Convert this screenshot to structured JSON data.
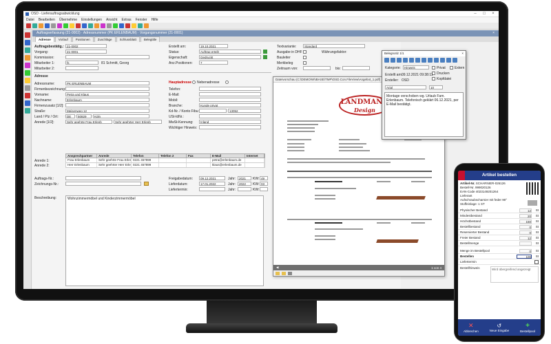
{
  "app": {
    "title": "OSD - Lieferauftragsabwicklung",
    "menu": [
      "Datei",
      "Bearbeiten",
      "Übernehme",
      "Einstellungen",
      "Ansicht",
      "Extras",
      "Fenster",
      "Hilfe"
    ],
    "subtitle": "Auftragserfassung (21-0002) · Adressnummer (PK ERLENBAUM) · Vorgangsnummer (21-0001)",
    "tabs": [
      "Adresse",
      "Vorlauf",
      "Positionen",
      "Zuschläge",
      "Schlussblatt",
      "Belegtitle"
    ]
  },
  "form": {
    "auftragsbestaetigung_label": "Auftragsbestätig.:",
    "auftragsbestaetigung": "21-0002",
    "vorgang_label": "Vorgang:",
    "vorgang": "21-0001",
    "kommission_label": "Kommission:",
    "mitarbeiter1_label": "Mitarbeiter 1:",
    "mitarbeiter1_code": "fs",
    "mitarbeiter1": "81 Schmitt, Georg",
    "mitarbeiter2_label": "Mitarbeiter 2:",
    "erstellt_label": "Erstellt am:",
    "erstellt": "19.10.2021",
    "status_label": "Status:",
    "status": "Auftrag erteilt",
    "eigenschaft_label": "Eigenschaft:",
    "eigenschaft": "Gedruckt",
    "anzpos_label": "Anz.Positionen:",
    "anzpos": "7",
    "textvariante_label": "Textvariante:",
    "textvariante": "Standard",
    "ausgabe_label": "Ausgabe in DHF",
    "waehrung_label": "Währungsfaktor:",
    "bauleiter_label": "Bauleiter",
    "merkbeleg_label": "Merkbeleg",
    "zeitraum_label": "Zeitraum von:",
    "bis_label": "bis:",
    "adresse_section": "Adresse",
    "hauptadresse_label": "Hauptadresse",
    "nebenadresse_label": "Nebenadresse",
    "adressname_label": "Adressname:",
    "adressname": "PK ERLENBAUM",
    "firmen_label": "Firmenbezeichnung:",
    "vorname_label": "Vorname:",
    "vorname": "Petra und Klaus",
    "nachname_label": "Nachname:",
    "nachname": "Erlenbaum",
    "firmenzusatz_label": "Firmenzusatz [1/2]:",
    "strasse_label": "Straße:",
    "strasse": "Meisenweg 12",
    "lpo_label": "Land / Plz / Ort:",
    "land": "DE",
    "plz": "50829",
    "ort": "Köln",
    "anrede_label": "Anrede [1/2]:",
    "anrede": "Sehr geehrte Frau Erlenb",
    "anrede2": "Sehr geehrter Herr Erlenb",
    "telefon_label": "Telefon:",
    "email_label": "E-Mail:",
    "mobil_label": "Mobil:",
    "branche_label": "Branche:",
    "branche": "Kunde privat",
    "kdnr_label": "Kd-Nr. / Konto Fibu:",
    "kdnr": "13052",
    "ustid_label": "USt-IdNr.:",
    "mwst_label": "MwSt-Kennung:",
    "mwst": "Inland",
    "hinweis_label": "Wichtiger Hinweis:",
    "auftragsnr_label": "Auftrags-Nr.:",
    "zeichnung_label": "Zeichnungs-Nr.:",
    "freigabe_label": "Freigabedatum:",
    "freigabe": "09.12.2021",
    "jahr_label": "Jahr:",
    "freigabe_jahr": "2021",
    "kw_label": "KW:",
    "freigabe_kw": "49",
    "liefer_label": "Lieferdatum:",
    "liefer": "17.01.2022",
    "liefer_jahr": "2022",
    "liefer_kw": "03",
    "liefertermin_label": "Liefertermin:",
    "liefertermin_jahr": "",
    "liefertermin_kw": "",
    "beschreibung_label": "Beschreibung:",
    "beschreibung": "Wohnzimmermöbel und Kinderzimmermöbel"
  },
  "contacts": {
    "headers": [
      "",
      "Ansprechpartner",
      "Anrede",
      "Telefon",
      "Telefon 2",
      "Fax",
      "E-Mail",
      "Internet"
    ],
    "rows": [
      [
        "Anrede 1:",
        "Frau Erlenbaum",
        "Sehr geehrte Frau Erlen",
        "0221 457899",
        "",
        "",
        "petra@erlenbaum.de",
        ""
      ],
      [
        "Anrede 2:",
        "Herr Erlenbaum",
        "Sehr geehrter Herr Erlen",
        "0221 457899",
        "",
        "",
        "klaus@erlenbaum.de",
        ""
      ]
    ]
  },
  "document": {
    "title": "Dateivorschau (C:\\DEMO\\W\\IBASE\\TMP\\OSD.Con.FileView\\Angebot_1.pdf)",
    "logo1": "LANDMANN",
    "logo2": "Design",
    "page": "1 von 4"
  },
  "note": {
    "title": "Belegnotiz 1/1",
    "kategorie_label": "Kategorie:",
    "kategorie": "Hinweis",
    "privat_label": "Privat",
    "extern_label": "Extern",
    "drucken_label": "Drucken",
    "kopf_label": "Kopfdatei",
    "erstellt_label": "Erstellt am:",
    "erstellt": "09.12.2021 09:38:11",
    "ersteller_label": "Ersteller:",
    "ersteller": "OSD",
    "font": "Arial",
    "size": "10",
    "text": "Montage verschoben wg. Urlaub Fam. Erlenbaum. Telefonisch geklärt 06.12.2021, per E-Mail bestätigt."
  },
  "phone": {
    "title": "Artikel bestellen",
    "artikel_label": "Artikel-Nr.",
    "artikel": "SCHARNIER-026126",
    "bestell_label": "Bestell-Nr.",
    "bestell": "999020126",
    "ean_label": "EAN-Code",
    "ean": "4023149201264",
    "lieferant_label": "Lieferant",
    "desc1": "Aufschraubscharnier mit feder 90°",
    "desc2": "Stoffeinlage: 1 ST",
    "rows": [
      {
        "k": "Physischer Bestand",
        "v": "12",
        "u": "St"
      },
      {
        "k": "Mindestbestand",
        "v": "20",
        "u": "St"
      },
      {
        "k": "Höchstbestand",
        "v": "150",
        "u": "St"
      },
      {
        "k": "Bestellbestand",
        "v": "0",
        "u": "St"
      },
      {
        "k": "Reservierter Bestand",
        "v": "0",
        "u": "St"
      },
      {
        "k": "Freier Bestand",
        "v": "12",
        "u": "St"
      },
      {
        "k": "Bestellmenge",
        "v": "",
        "u": "St"
      }
    ],
    "menge_label": "Menge im Bestellpool",
    "menge": "0",
    "bestellen_label": "Bestellen",
    "bestellen": "100",
    "liefertermin_label": "Liefertermin",
    "hinweis_label": "Bestellhinweis",
    "hinweis": "Wird übergreifend angezeigt",
    "btn_abbrechen": "Abbrechen",
    "btn_neu": "Neue Eingabe",
    "btn_bestellen": "Bestellpool"
  },
  "colors": {
    "accent": "#243e8a",
    "brand_red": "#c8102e",
    "header": "#7a93b6"
  }
}
